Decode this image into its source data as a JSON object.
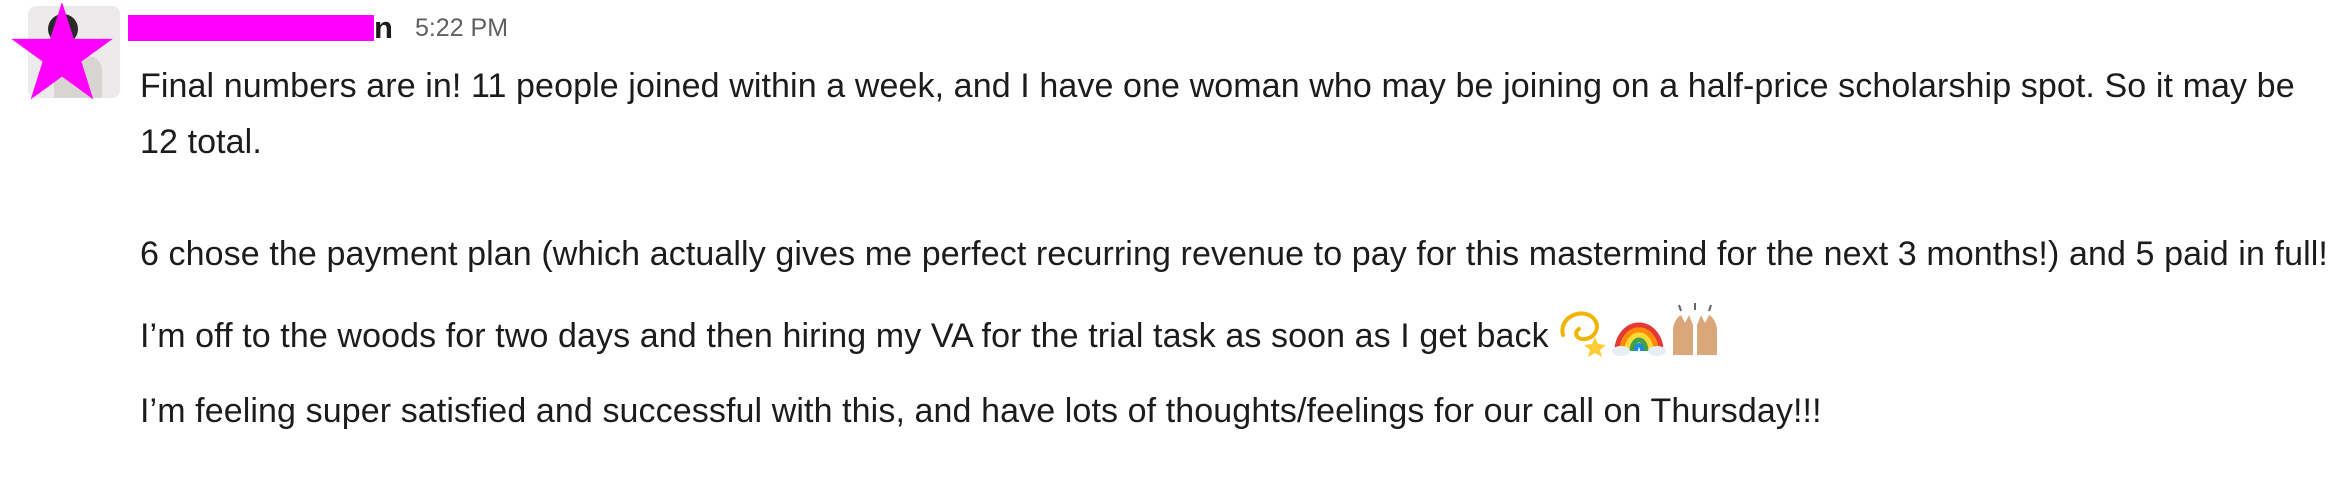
{
  "message": {
    "author_visible_suffix": "n",
    "timestamp": "5:22 PM",
    "paragraphs": [
      "Final numbers are in! 11 people joined within a week, and I have one woman who may be joining on a half-price scholarship spot. So it may be 12 total.",
      "6 chose the payment plan (which actually gives me perfect recurring revenue to pay for this mastermind for the next 3 months!) and 5 paid in full!",
      "I’m off to the woods for two days and then hiring my VA for the trial task as soon as I get back",
      "I’m feeling super satisfied and successful with this, and have lots of thoughts/feelings for our call on Thursday!!!"
    ],
    "emojis": [
      "dizzy-icon",
      "rainbow-icon",
      "raising-hands-icon"
    ]
  },
  "colors": {
    "redaction": "#ff00ff",
    "text": "#1d1c1d",
    "timestamp": "#616061"
  }
}
